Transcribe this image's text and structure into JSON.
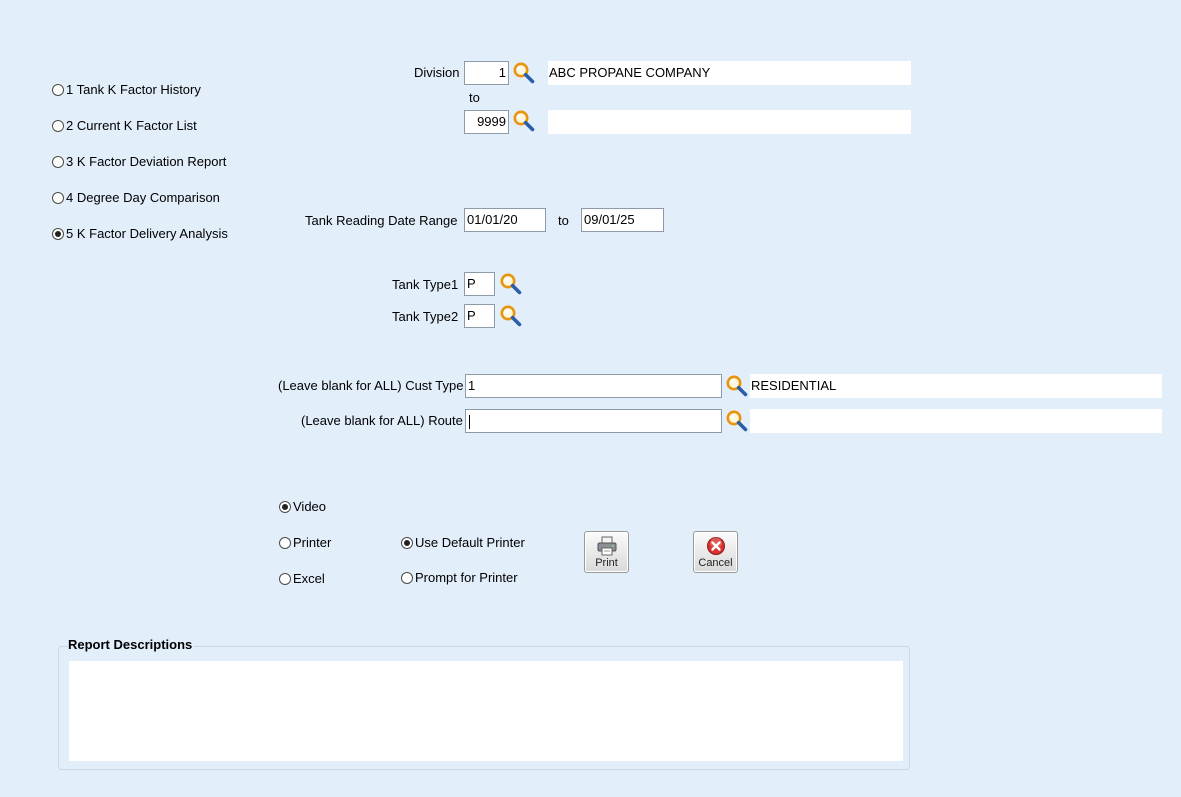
{
  "reports": [
    {
      "label": "1 Tank K Factor History",
      "selected": false
    },
    {
      "label": "2 Current K Factor List",
      "selected": false
    },
    {
      "label": "3 K Factor Deviation Report",
      "selected": false
    },
    {
      "label": "4 Degree Day Comparison",
      "selected": false
    },
    {
      "label": "5 K Factor Delivery Analysis",
      "selected": true
    }
  ],
  "division": {
    "label": "Division",
    "from_value": "1",
    "from_desc": "ABC PROPANE COMPANY",
    "to_label": "to",
    "to_value": "9999",
    "to_desc": ""
  },
  "date_range": {
    "label": "Tank Reading Date Range",
    "from": "01/01/20",
    "to_label": "to",
    "to": "09/01/25"
  },
  "tank_type1": {
    "label": "Tank Type1",
    "value": "P"
  },
  "tank_type2": {
    "label": "Tank Type2",
    "value": "P"
  },
  "cust_type": {
    "label": "(Leave blank for ALL) Cust Type",
    "value": "1",
    "desc": "RESIDENTIAL"
  },
  "route": {
    "label": "(Leave blank for ALL) Route",
    "value": "",
    "desc": ""
  },
  "output": {
    "video": {
      "label": "Video",
      "selected": true
    },
    "printer": {
      "label": "Printer",
      "selected": false
    },
    "excel": {
      "label": "Excel",
      "selected": false
    }
  },
  "printer_choice": {
    "default": {
      "label": "Use Default Printer",
      "selected": true
    },
    "prompt": {
      "label": "Prompt for Printer",
      "selected": false
    }
  },
  "buttons": {
    "print": "Print",
    "cancel": "Cancel"
  },
  "report_descriptions": {
    "title": "Report Descriptions",
    "text": ""
  },
  "icons": {
    "lookup": "magnifier-icon",
    "print": "printer-icon",
    "cancel": "cancel-icon"
  },
  "colors": {
    "background": "#e3eefb",
    "cancel_red": "#d93030",
    "magnifier_orange": "#e8940f",
    "magnifier_blue": "#2a5fa8"
  }
}
